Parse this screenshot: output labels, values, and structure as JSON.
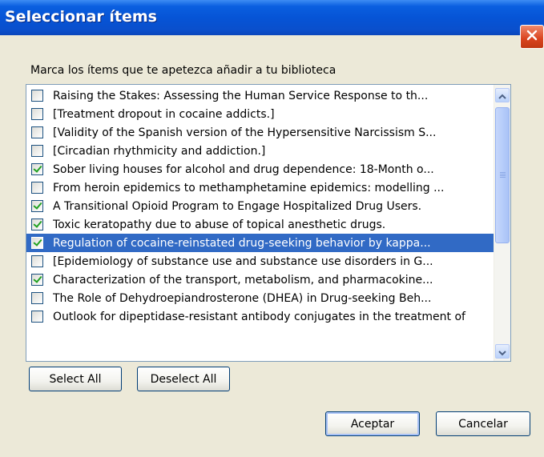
{
  "window": {
    "title": "Seleccionar ítems",
    "close_icon": "close-icon"
  },
  "instruction": "Marca los ítems que te apetezca añadir a tu biblioteca",
  "items": [
    {
      "label": "Raising the Stakes: Assessing the Human Service Response to th...",
      "checked": false,
      "selected": false
    },
    {
      "label": "[Treatment dropout in cocaine addicts.]",
      "checked": false,
      "selected": false
    },
    {
      "label": "[Validity of the Spanish version of the Hypersensitive Narcissism S...",
      "checked": false,
      "selected": false
    },
    {
      "label": "[Circadian rhythmicity and addiction.]",
      "checked": false,
      "selected": false
    },
    {
      "label": "Sober living houses for alcohol and drug dependence: 18-Month o...",
      "checked": true,
      "selected": false
    },
    {
      "label": "From heroin epidemics to methamphetamine epidemics: modelling ...",
      "checked": false,
      "selected": false
    },
    {
      "label": "A Transitional Opioid Program to Engage Hospitalized Drug Users.",
      "checked": true,
      "selected": false
    },
    {
      "label": "Toxic keratopathy due to abuse of topical anesthetic drugs.",
      "checked": true,
      "selected": false
    },
    {
      "label": "Regulation of cocaine-reinstated drug-seeking behavior by kappa...",
      "checked": true,
      "selected": true
    },
    {
      "label": "[Epidemiology of substance use and substance use disorders in G...",
      "checked": false,
      "selected": false
    },
    {
      "label": "Characterization of the transport, metabolism, and pharmacokine...",
      "checked": true,
      "selected": false
    },
    {
      "label": "The Role of Dehydroepiandrosterone (DHEA) in Drug-seeking Beh...",
      "checked": false,
      "selected": false
    },
    {
      "label": "Outlook for dipeptidase-resistant antibody conjugates in the treatment of",
      "checked": false,
      "selected": false
    }
  ],
  "buttons": {
    "select_all": "Select All",
    "deselect_all": "Deselect All",
    "accept": "Aceptar",
    "cancel": "Cancelar"
  },
  "colors": {
    "titlebar": "#0654d6",
    "selection": "#316ac5",
    "check": "#21a121",
    "dialog_bg": "#ece9d8"
  }
}
